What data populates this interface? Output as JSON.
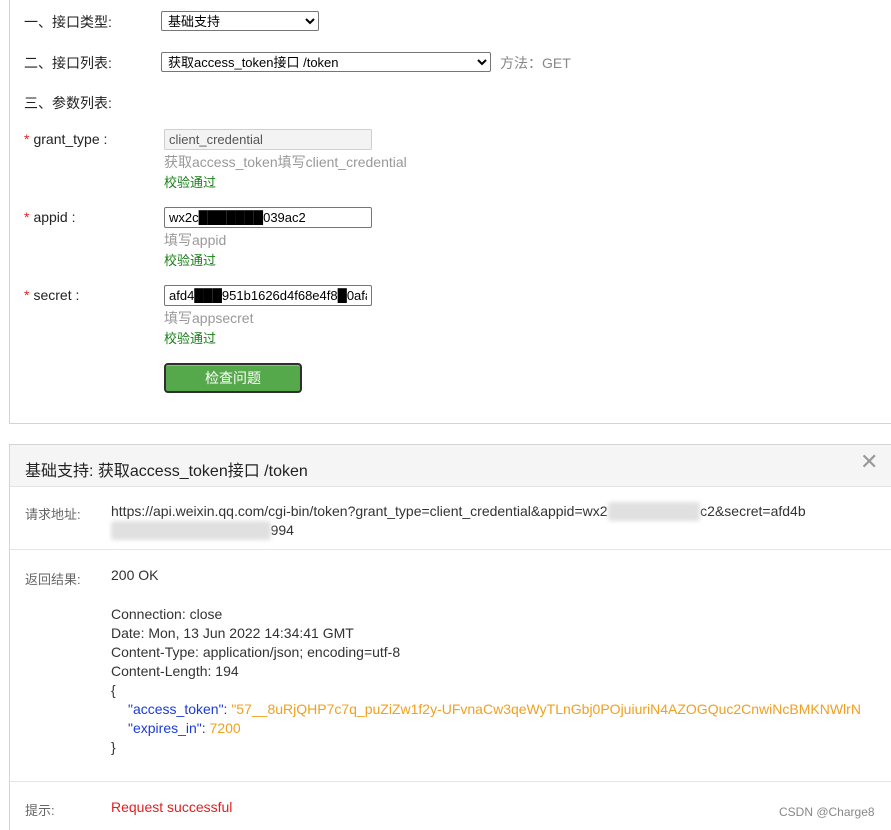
{
  "form": {
    "type_label": "一、接口类型:",
    "type_value": "基础支持",
    "list_label": "二、接口列表:",
    "list_value": "获取access_token接口 /token",
    "method": "方法：GET",
    "params_label": "三、参数列表:",
    "required_mark": "*",
    "params": [
      {
        "label": "grant_type :",
        "value": "client_credential",
        "hint": "获取access_token填写client_credential",
        "status": "校验通过"
      },
      {
        "label": "appid :",
        "value": "wx2c███████039ac2",
        "hint": "填写appid",
        "status": "校验通过"
      },
      {
        "label": "secret :",
        "value": "afd4███951b1626d4f68e4f8█0afae",
        "hint": "填写appsecret",
        "status": "校验通过"
      }
    ],
    "check_button": "检查问题"
  },
  "result": {
    "title": "基础支持: 获取access_token接口 /token",
    "close": "✕",
    "url_label": "请求地址:",
    "url_line1": "https://api.weixin.qq.com/cgi-bin/token?grant_type=client_credential&appid=wx2",
    "url_blur1": "c1f09d0f1039a",
    "url_line1_end": "c2&secret=afd4b",
    "url_blur2": "1951b1626d4f68e4f8b0af",
    "url_line2_end": "994",
    "result_label": "返回结果:",
    "status": "200 OK",
    "headers": [
      "Connection: close",
      "Date: Mon, 13 Jun 2022 14:34:41 GMT",
      "Content-Type: application/json; encoding=utf-8",
      "Content-Length: 194"
    ],
    "json_open": "{",
    "json_close": "}",
    "json_key1": "\"access_token\"",
    "json_val1": "\"57__8uRjQHP7c7q_puZiZw1f2y-UFvnaCw3qeWyTLnGbj0POjuiuriN4AZOGQuc2CnwiNcBMKNWlrN",
    "json_key2": "\"expires_in\"",
    "json_val2": "7200",
    "tip_label": "提示:",
    "tip_value": "Request successful"
  },
  "watermark": "CSDN @Charge8"
}
